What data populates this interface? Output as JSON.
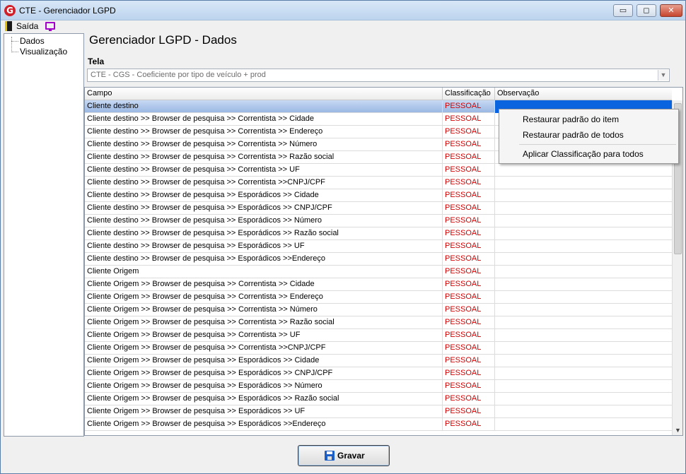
{
  "window": {
    "title": "CTE - Gerenciador LGPD",
    "app_icon_letter": "G",
    "minimize_glyph": "▭",
    "maximize_glyph": "◻",
    "close_glyph": "✕"
  },
  "menu": {
    "exit_label": "Saída"
  },
  "tree": {
    "items": [
      "Dados",
      "Visualização"
    ]
  },
  "page": {
    "title": "Gerenciador LGPD - Dados",
    "tela_label": "Tela",
    "tela_value": "CTE - CGS - Coeficiente por tipo de veículo + prod",
    "select_arrow": "▼"
  },
  "grid": {
    "columns": [
      "Campo",
      "Classificação",
      "Observação"
    ],
    "rows": [
      {
        "campo": "Cliente destino",
        "classificacao": "PESSOAL",
        "observacao": ""
      },
      {
        "campo": "Cliente destino >> Browser de pesquisa >> Correntista >> Cidade",
        "classificacao": "PESSOAL",
        "observacao": ""
      },
      {
        "campo": "Cliente destino >> Browser de pesquisa >> Correntista >> Endereço",
        "classificacao": "PESSOAL",
        "observacao": ""
      },
      {
        "campo": "Cliente destino >> Browser de pesquisa >> Correntista >> Número",
        "classificacao": "PESSOAL",
        "observacao": ""
      },
      {
        "campo": "Cliente destino >> Browser de pesquisa >> Correntista >> Razão social",
        "classificacao": "PESSOAL",
        "observacao": ""
      },
      {
        "campo": "Cliente destino >> Browser de pesquisa >> Correntista >> UF",
        "classificacao": "PESSOAL",
        "observacao": ""
      },
      {
        "campo": "Cliente destino >> Browser de pesquisa >> Correntista >>CNPJ/CPF",
        "classificacao": "PESSOAL",
        "observacao": ""
      },
      {
        "campo": "Cliente destino >> Browser de pesquisa >> Esporádicos >> Cidade",
        "classificacao": "PESSOAL",
        "observacao": ""
      },
      {
        "campo": "Cliente destino >> Browser de pesquisa >> Esporádicos >> CNPJ/CPF",
        "classificacao": "PESSOAL",
        "observacao": ""
      },
      {
        "campo": "Cliente destino >> Browser de pesquisa >> Esporádicos >> Número",
        "classificacao": "PESSOAL",
        "observacao": ""
      },
      {
        "campo": "Cliente destino >> Browser de pesquisa >> Esporádicos >> Razão social",
        "classificacao": "PESSOAL",
        "observacao": ""
      },
      {
        "campo": "Cliente destino >> Browser de pesquisa >> Esporádicos >> UF",
        "classificacao": "PESSOAL",
        "observacao": ""
      },
      {
        "campo": "Cliente destino >> Browser de pesquisa >> Esporádicos >>Endereço",
        "classificacao": "PESSOAL",
        "observacao": ""
      },
      {
        "campo": "Cliente Origem",
        "classificacao": "PESSOAL",
        "observacao": ""
      },
      {
        "campo": "Cliente Origem >> Browser de pesquisa >> Correntista >> Cidade",
        "classificacao": "PESSOAL",
        "observacao": ""
      },
      {
        "campo": "Cliente Origem >> Browser de pesquisa >> Correntista >> Endereço",
        "classificacao": "PESSOAL",
        "observacao": ""
      },
      {
        "campo": "Cliente Origem >> Browser de pesquisa >> Correntista >> Número",
        "classificacao": "PESSOAL",
        "observacao": ""
      },
      {
        "campo": "Cliente Origem >> Browser de pesquisa >> Correntista >> Razão social",
        "classificacao": "PESSOAL",
        "observacao": ""
      },
      {
        "campo": "Cliente Origem >> Browser de pesquisa >> Correntista >> UF",
        "classificacao": "PESSOAL",
        "observacao": ""
      },
      {
        "campo": "Cliente Origem >> Browser de pesquisa >> Correntista >>CNPJ/CPF",
        "classificacao": "PESSOAL",
        "observacao": ""
      },
      {
        "campo": "Cliente Origem >> Browser de pesquisa >> Esporádicos >> Cidade",
        "classificacao": "PESSOAL",
        "observacao": ""
      },
      {
        "campo": "Cliente Origem >> Browser de pesquisa >> Esporádicos >> CNPJ/CPF",
        "classificacao": "PESSOAL",
        "observacao": ""
      },
      {
        "campo": "Cliente Origem >> Browser de pesquisa >> Esporádicos >> Número",
        "classificacao": "PESSOAL",
        "observacao": ""
      },
      {
        "campo": "Cliente Origem >> Browser de pesquisa >> Esporádicos >> Razão social",
        "classificacao": "PESSOAL",
        "observacao": ""
      },
      {
        "campo": "Cliente Origem >> Browser de pesquisa >> Esporádicos >> UF",
        "classificacao": "PESSOAL",
        "observacao": ""
      },
      {
        "campo": "Cliente Origem >> Browser de pesquisa >> Esporádicos >>Endereço",
        "classificacao": "PESSOAL",
        "observacao": ""
      }
    ],
    "selected_row": 0,
    "scroll_down_glyph": "▼"
  },
  "context_menu": {
    "items": [
      "Restaurar padrão do item",
      "Restaurar padrão de todos",
      "Aplicar Classificação para todos"
    ]
  },
  "footer": {
    "save_label": "Gravar"
  },
  "colors": {
    "classification_text": "#d10000",
    "selection_blue": "#0a64e0",
    "accent_icon": "#a200c8"
  },
  "icons": {
    "exit": "exit-door-icon",
    "monitor": "monitor-icon",
    "save": "floppy-disk-icon",
    "app": "app-logo-icon"
  }
}
